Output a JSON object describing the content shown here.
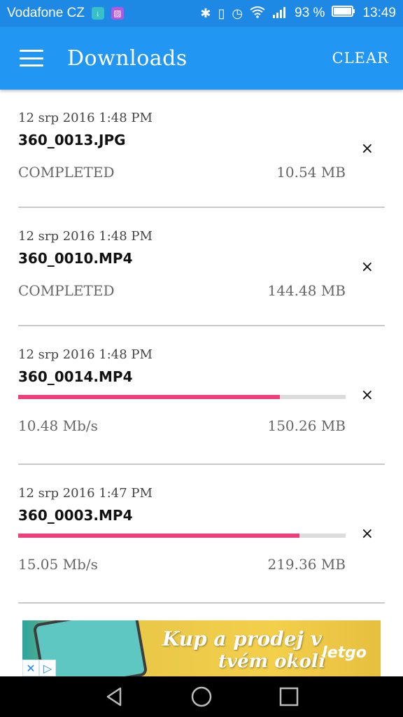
{
  "status_bar": {
    "carrier": "Vodafone CZ",
    "battery": "93 %",
    "time": "13:49",
    "icons": [
      "download-notif-icon",
      "image-notif-icon",
      "bluetooth-icon",
      "vibrate-icon",
      "alarm-icon",
      "wifi-icon",
      "signal-icon",
      "battery-icon"
    ]
  },
  "app_bar": {
    "title": "Downloads",
    "clear_label": "CLEAR",
    "color": "#2196f3"
  },
  "downloads": [
    {
      "date": "12 srp 2016 1:48 PM",
      "filename": "360_0013.JPG",
      "status": "COMPLETED",
      "size": "10.54 MB"
    },
    {
      "date": "12 srp 2016 1:48 PM",
      "filename": "360_0010.MP4",
      "status": "COMPLETED",
      "size": "144.48 MB"
    },
    {
      "date": "12 srp 2016 1:48 PM",
      "filename": "360_0014.MP4",
      "speed": "10.48 Mb/s",
      "size": "150.26 MB",
      "progress_percent": 80
    },
    {
      "date": "12 srp 2016 1:47 PM",
      "filename": "360_0003.MP4",
      "speed": "15.05 Mb/s",
      "size": "219.36 MB",
      "progress_percent": 86
    }
  ],
  "close_glyph": "×",
  "progress_color": "#ee3f7a",
  "ad": {
    "line1": "Kup a prodej v",
    "line2": "tvém okolí",
    "brand": "letgo"
  }
}
